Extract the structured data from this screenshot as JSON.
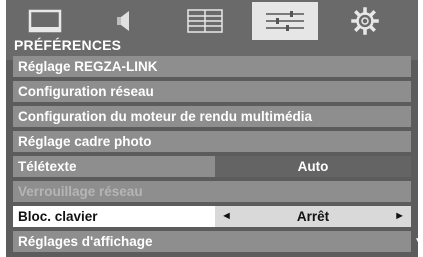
{
  "menu_title": "PRÉFÉRENCES",
  "tabs": [
    {
      "icon": "picture-icon",
      "active": false
    },
    {
      "icon": "sound-icon",
      "active": false
    },
    {
      "icon": "setup-icon",
      "active": false
    },
    {
      "icon": "preferences-sliders-icon",
      "active": true
    },
    {
      "icon": "gear-icon",
      "active": false
    }
  ],
  "items": [
    {
      "label": "Réglage REGZA-LINK"
    },
    {
      "label": "Configuration réseau"
    },
    {
      "label": "Configuration du moteur de rendu multimédia"
    },
    {
      "label": "Réglage cadre photo"
    },
    {
      "label": "Télétexte",
      "value": "Auto"
    },
    {
      "label": "Verrouillage réseau",
      "disabled": true
    },
    {
      "label": "Bloc. clavier",
      "value": "Arrêt",
      "selected": true,
      "left_arrow": "◄",
      "right_arrow": "►"
    },
    {
      "label": "Réglages d'affichage"
    }
  ],
  "scroll_indicator": "▼"
}
